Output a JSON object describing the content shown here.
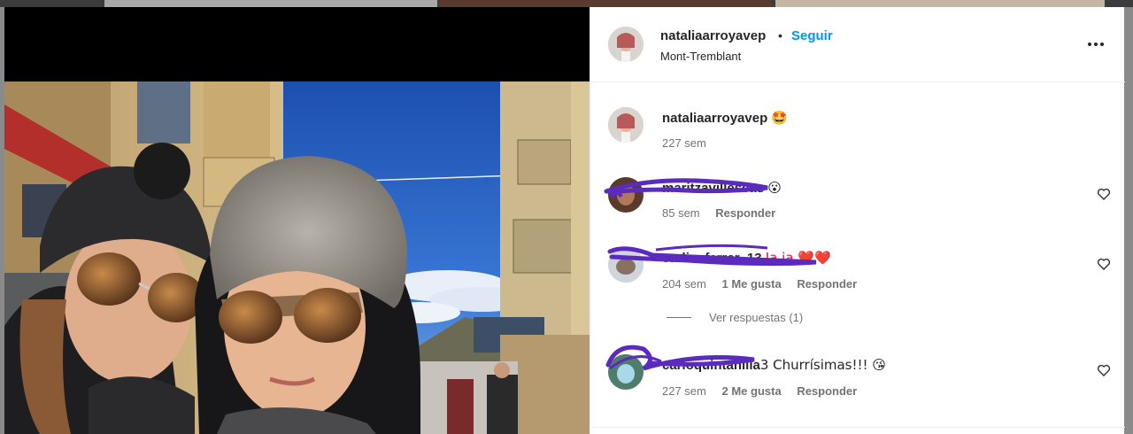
{
  "post": {
    "author": "nataliaarroyavep",
    "separator": "•",
    "follow_label": "Seguir",
    "location": "Mont-Tremblant",
    "more_icon": "more-horizontal-icon",
    "caption": {
      "user": "nataliaarroyavep",
      "text": "🤩",
      "time": "227 sem"
    }
  },
  "comments": [
    {
      "user": "maritzavillescas",
      "text": "😮",
      "time": "85 sem",
      "likes": "",
      "reply_label": "Responder"
    },
    {
      "user": "carlinaferrer_13",
      "text": "Ja ja ❤️❤️",
      "time": "204 sem",
      "likes": "1 Me gusta",
      "reply_label": "Responder",
      "view_replies": "Ver respuestas (1)"
    },
    {
      "user": "carloquintanilla",
      "text": "3 Churrísimas!!! 😘",
      "time": "227 sem",
      "likes": "2 Me gusta",
      "reply_label": "Responder"
    }
  ],
  "colors": {
    "accent": "#0095f6",
    "text": "#262626",
    "muted": "#737373",
    "scribble": "#5b2bbd",
    "heart_red": "#e0112b"
  }
}
